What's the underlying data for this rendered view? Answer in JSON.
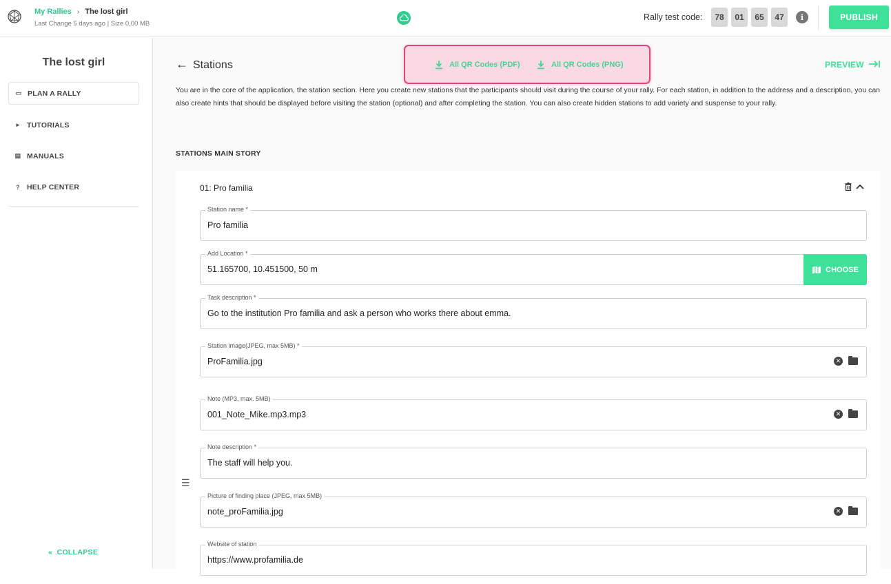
{
  "header": {
    "breadcrumb_root": "My Rallies",
    "breadcrumb_sep": "›",
    "breadcrumb_current": "The lost girl",
    "meta": "Last Change 5 days ago | Size 0,00 MB",
    "test_code_label": "Rally test code:",
    "test_code": [
      "78",
      "01",
      "65",
      "47"
    ],
    "info_icon": "i",
    "publish_label": "PUBLISH"
  },
  "sidebar": {
    "title": "The lost girl",
    "items": [
      {
        "label": "PLAN A RALLY",
        "icon": "▭"
      },
      {
        "label": "TUTORIALS",
        "icon": "▸"
      },
      {
        "label": "MANUALS",
        "icon": "▤"
      },
      {
        "label": "HELP CENTER",
        "icon": "?"
      }
    ],
    "collapse_label": "COLLAPSE"
  },
  "main": {
    "back_icon": "←",
    "title": "Stations",
    "qr_pdf_label": "All QR Codes (PDF)",
    "qr_png_label": "All QR Codes (PNG)",
    "preview_label": "PREVIEW",
    "intro": "You are in the core of the application, the station section. Here you create new stations that the participants should visit during the course of your rally. For each station, in addition to the address and a description, you can also create hints that should be displayed before visiting the station (optional) and after completing the station. You can also create hidden stations to add variety and suspense to your rally.",
    "section_heading": "STATIONS MAIN STORY",
    "station": {
      "title": "01: Pro familia",
      "fields": [
        {
          "label": "Station name *",
          "value": "Pro familia"
        },
        {
          "label": "Add Location *",
          "value": "51.165700, 10.451500, 50 m",
          "button": "CHOOSE"
        },
        {
          "label": "Task description *",
          "value": "Go to the institution Pro familia and ask a person who works there about emma."
        },
        {
          "label": "Station image(JPEG, max 5MB) *",
          "value": "ProFamilia.jpg"
        },
        {
          "label": "Note (MP3, max. 5MB)",
          "value": "001_Note_Mike.mp3.mp3"
        },
        {
          "label": "Note description *",
          "value": "The staff will help you."
        },
        {
          "label": "Picture of finding place (JPEG, max 5MB)",
          "value": "note_proFamilia.jpg"
        },
        {
          "label": "Website of station",
          "value": "https://www.profamilia.de"
        }
      ]
    }
  },
  "colors": {
    "accent": "#3ee09a",
    "highlight_border": "#e0457f",
    "highlight_fill": "#fbd9e4"
  }
}
